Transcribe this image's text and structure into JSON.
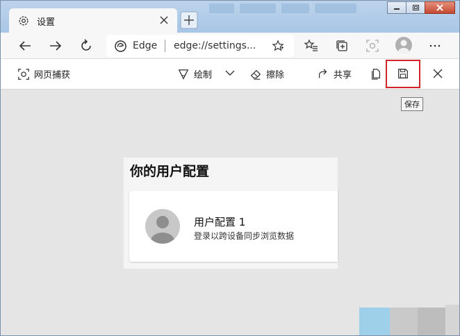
{
  "tab": {
    "title": "设置",
    "close_icon": "close-icon",
    "settings_icon": "gear-icon"
  },
  "address": {
    "site_label": "Edge",
    "url": "edge://settings..."
  },
  "capture_toolbar": {
    "web_capture_label": "网页捕获",
    "draw_label": "绘制",
    "erase_label": "擦除",
    "share_label": "共享",
    "save_tooltip": "保存"
  },
  "profile": {
    "heading": "你的用户配置",
    "name": "用户配置 1",
    "description": "登录以跨设备同步浏览数据"
  },
  "colors": {
    "highlight": "#d0232a",
    "tabstrip": "#bcd3ec"
  }
}
